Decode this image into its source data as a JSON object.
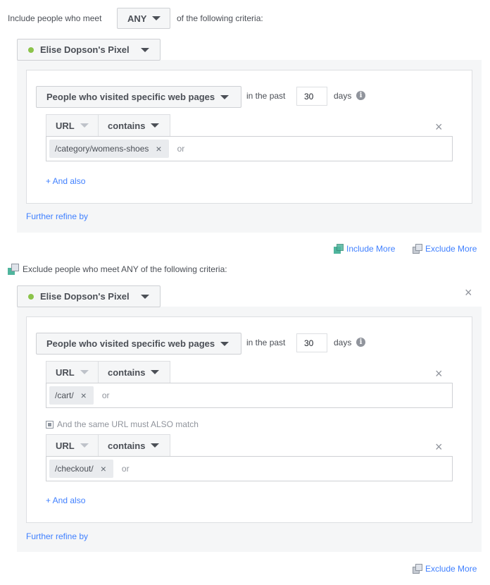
{
  "include": {
    "prefix": "Include people who meet",
    "match_select": "ANY",
    "suffix": "of the following criteria:",
    "pixel": "Elise Dopson's Pixel",
    "rule": {
      "type_select": "People who visited specific web pages",
      "in_the_past": "in the past",
      "days_value": "30",
      "days_label": "days",
      "conditions": [
        {
          "field": "URL",
          "operator": "contains",
          "tokens": [
            "/category/womens-shoes"
          ],
          "or_label": "or"
        }
      ],
      "and_also": "+ And also"
    },
    "further_refine": "Further refine by"
  },
  "actions": {
    "include_more": "Include More",
    "exclude_more": "Exclude More"
  },
  "exclude": {
    "header": "Exclude people who meet ANY of the following criteria:",
    "pixel": "Elise Dopson's Pixel",
    "rule": {
      "type_select": "People who visited specific web pages",
      "in_the_past": "in the past",
      "days_value": "30",
      "days_label": "days",
      "conditions": [
        {
          "field": "URL",
          "operator": "contains",
          "tokens": [
            "/cart/"
          ],
          "or_label": "or"
        },
        {
          "field": "URL",
          "operator": "contains",
          "tokens": [
            "/checkout/"
          ],
          "or_label": "or"
        }
      ],
      "also_match": "And the same URL must ALSO match",
      "and_also": "+ And also"
    },
    "further_refine": "Further refine by"
  },
  "footer": {
    "exclude_more": "Exclude More"
  },
  "icons": {
    "close": "×",
    "info": "i"
  },
  "colors": {
    "link": "#4080ff",
    "pixel_status": "#8bc34a",
    "include_icon": "#4fb59d"
  }
}
